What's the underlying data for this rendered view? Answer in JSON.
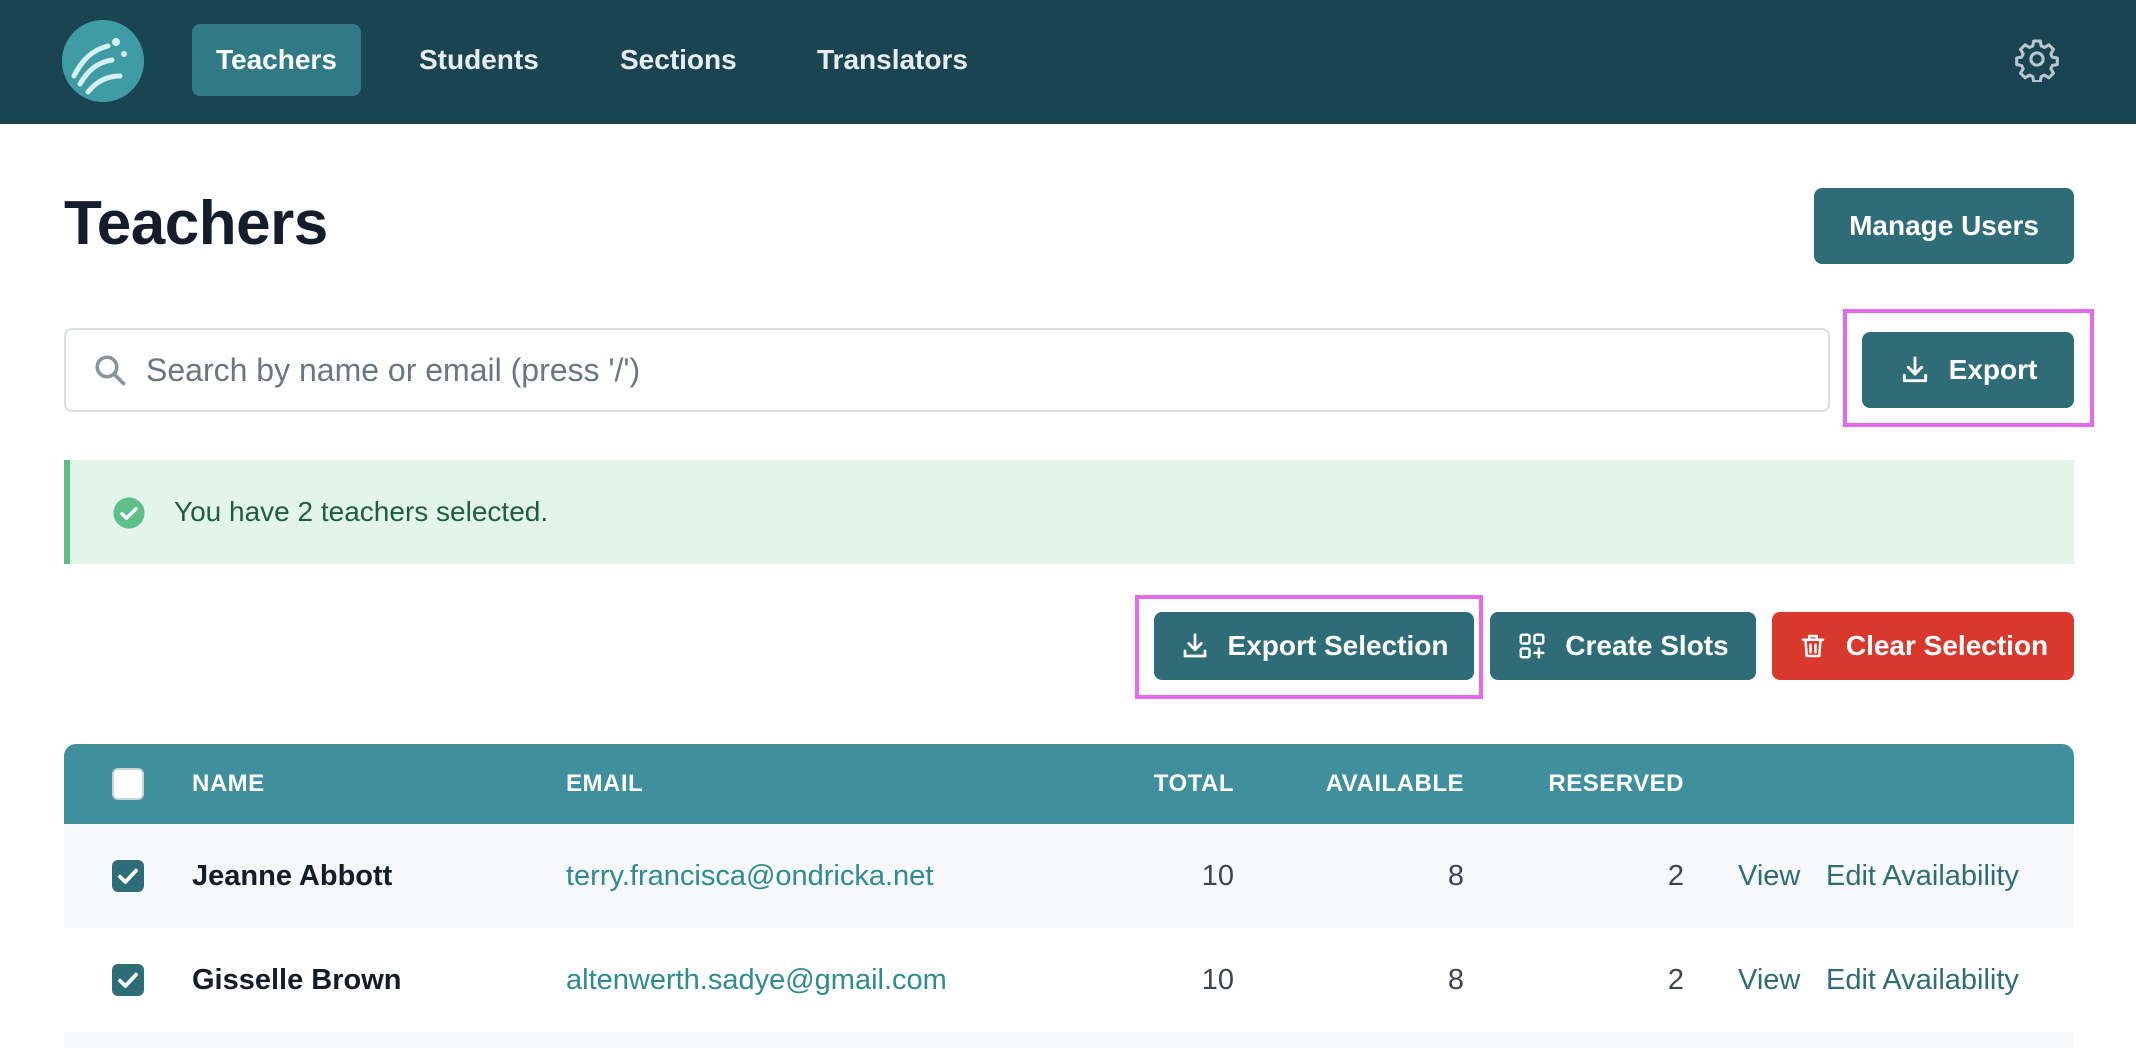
{
  "nav": {
    "items": [
      {
        "label": "Teachers",
        "active": true
      },
      {
        "label": "Students",
        "active": false
      },
      {
        "label": "Sections",
        "active": false
      },
      {
        "label": "Translators",
        "active": false
      }
    ],
    "logo_icon": "wave-logo-icon",
    "settings_icon": "gear-icon"
  },
  "page": {
    "title": "Teachers",
    "manage_users_label": "Manage Users"
  },
  "search": {
    "placeholder": "Search by name or email (press '/')",
    "value": ""
  },
  "export": {
    "label": "Export",
    "icon": "download-icon"
  },
  "alert": {
    "text": "You have 2 teachers selected.",
    "icon": "check-circle-icon"
  },
  "actions": {
    "export_selection": "Export Selection",
    "create_slots": "Create Slots",
    "clear_selection": "Clear Selection"
  },
  "table": {
    "headers": {
      "name": "NAME",
      "email": "EMAIL",
      "total": "TOTAL",
      "available": "AVAILABLE",
      "reserved": "RESERVED"
    },
    "rows": [
      {
        "checked": true,
        "name": "Jeanne Abbott",
        "email": "terry.francisca@ondricka.net",
        "total": "10",
        "available": "8",
        "reserved": "2",
        "view": "View",
        "edit": "Edit Availability"
      },
      {
        "checked": true,
        "name": "Gisselle Brown",
        "email": "altenwerth.sadye@gmail.com",
        "total": "10",
        "available": "8",
        "reserved": "2",
        "view": "View",
        "edit": "Edit Availability"
      }
    ]
  },
  "colors": {
    "nav_bg": "#1b4453",
    "primary": "#2e6d78",
    "danger": "#d9392d",
    "table_header": "#3f909c",
    "highlight": "#e468f0",
    "success_bg": "#e3f5eb"
  }
}
